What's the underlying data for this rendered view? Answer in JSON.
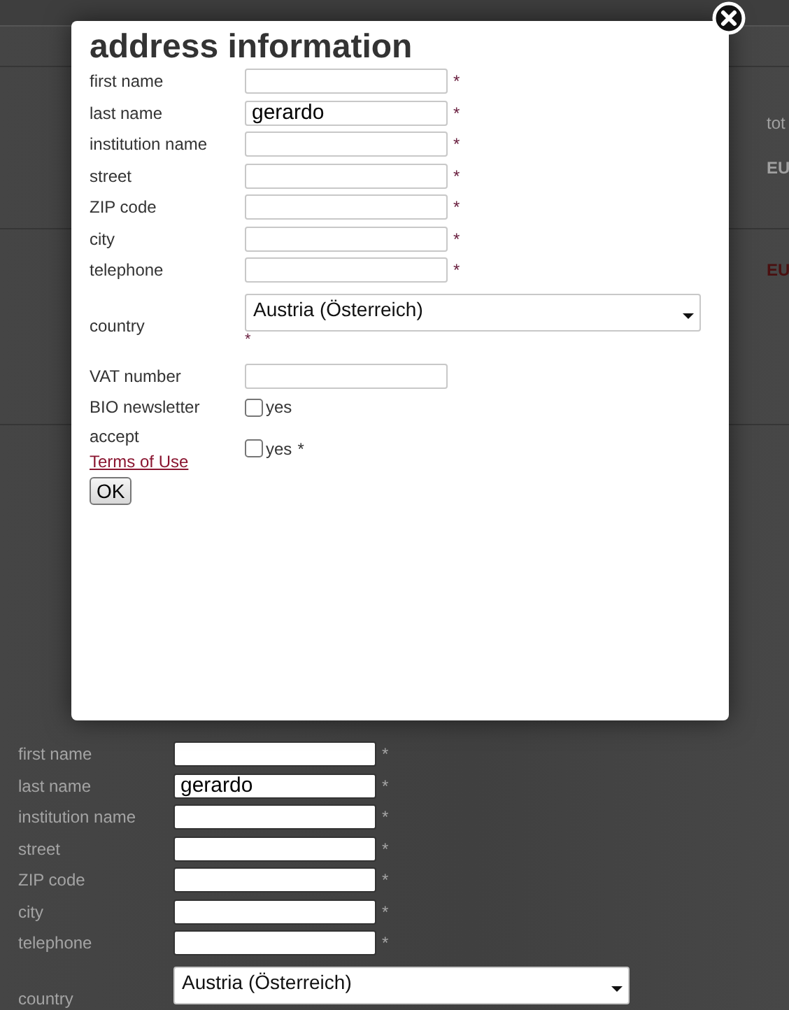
{
  "background_page": {
    "side_texts": [
      {
        "text": "tot",
        "kind": "heading"
      },
      {
        "text": "EU",
        "kind": "amount"
      },
      {
        "text": "EU",
        "kind": "price"
      }
    ],
    "form": {
      "fields": [
        {
          "label": "first name",
          "kind": "text",
          "required_mark": "*"
        },
        {
          "label": "last name",
          "kind": "text",
          "value": "gerardo",
          "required_mark": "*"
        },
        {
          "label": "institution name",
          "kind": "text",
          "required_mark": "*"
        },
        {
          "label": "street",
          "kind": "text",
          "required_mark": "*"
        },
        {
          "label": "ZIP code",
          "kind": "text",
          "required_mark": "*"
        },
        {
          "label": "city",
          "kind": "text",
          "required_mark": "*"
        },
        {
          "label": "telephone",
          "kind": "text",
          "required_mark": "*"
        },
        {
          "label": "country",
          "kind": "select",
          "value": "Austria (Österreich)"
        }
      ]
    }
  },
  "dialog": {
    "title": "address information",
    "fields": [
      {
        "label": "first name",
        "kind": "text",
        "required_mark": "*"
      },
      {
        "label": "last name",
        "kind": "text",
        "value": "gerardo",
        "required_mark": "*"
      },
      {
        "label": "institution name",
        "kind": "text",
        "required_mark": "*"
      },
      {
        "label": "street",
        "kind": "text",
        "required_mark": "*"
      },
      {
        "label": "ZIP code",
        "kind": "text",
        "required_mark": "*"
      },
      {
        "label": "city",
        "kind": "text",
        "required_mark": "*"
      },
      {
        "label": "telephone",
        "kind": "text",
        "required_mark": "*"
      },
      {
        "label": "country",
        "kind": "select",
        "value": "Austria (Österreich)",
        "required_mark": "*"
      },
      {
        "label": "VAT number",
        "kind": "text"
      },
      {
        "label": "BIO newsletter",
        "kind": "checkbox",
        "checked": false,
        "option": "yes"
      },
      {
        "label": "accept",
        "link": "Terms of Use",
        "kind": "checkbox",
        "checked": false,
        "option": "yes",
        "required_mark": "*"
      }
    ],
    "submit": "OK"
  }
}
